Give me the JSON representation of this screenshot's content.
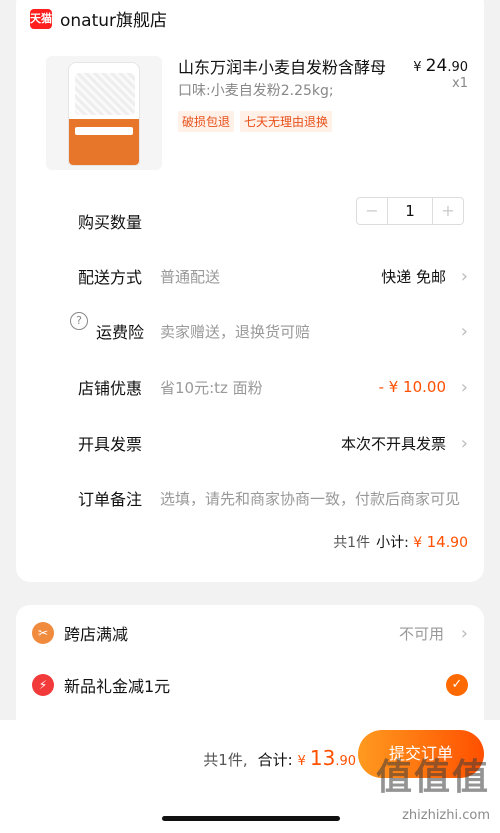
{
  "store": {
    "badge": "天猫",
    "name": "onatur旗舰店"
  },
  "product": {
    "title": "山东万润丰小麦自发粉含酵母",
    "spec": "口味:小麦自发粉2.25kg;",
    "price_currency": "¥ ",
    "price_int": "24",
    "price_dec": ".90",
    "quantity_x": "x1",
    "tags": [
      "破损包退",
      "七天无理由退换"
    ]
  },
  "rows": {
    "quantity": {
      "label": "购买数量",
      "minus": "−",
      "value": "1",
      "plus": "+"
    },
    "delivery": {
      "label": "配送方式",
      "desc": "普通配送",
      "value": "快递 免邮"
    },
    "insurance": {
      "label": "运费险",
      "icon": "?",
      "desc": "卖家赠送，退换货可赔"
    },
    "store_discount": {
      "label": "店铺优惠",
      "desc": "省10元:tz 面粉",
      "value": "- ¥ 10.00"
    },
    "invoice": {
      "label": "开具发票",
      "value": "本次不开具发票"
    },
    "note": {
      "label": "订单备注",
      "desc": "选填，请先和商家协商一致，付款后商家可见"
    }
  },
  "subtotal": {
    "count": "共1件",
    "label": "小计:",
    "currency": "¥ ",
    "int": "14",
    "dec": ".90"
  },
  "promos": {
    "cross_store": {
      "label": "跨店满减",
      "value": "不可用"
    },
    "gift": {
      "label": "新品礼金减1元"
    }
  },
  "bottom": {
    "count": "共1件,",
    "total_label": "合计:",
    "currency": "¥ ",
    "int": "13",
    "dec": ".90",
    "submit": "提交订单"
  },
  "watermark": {
    "logo": "值值值",
    "url": "zhizhizhi.com"
  },
  "colors": {
    "accent": "#ff5000",
    "tmall_red": "#ff1f1f",
    "tag_bg": "#fff0e8"
  },
  "icons": {
    "store": "tmall-icon",
    "chevron": "chevron-right-icon",
    "cross_store": "coupon-icon",
    "gift": "lightning-icon",
    "check": "check-icon"
  }
}
